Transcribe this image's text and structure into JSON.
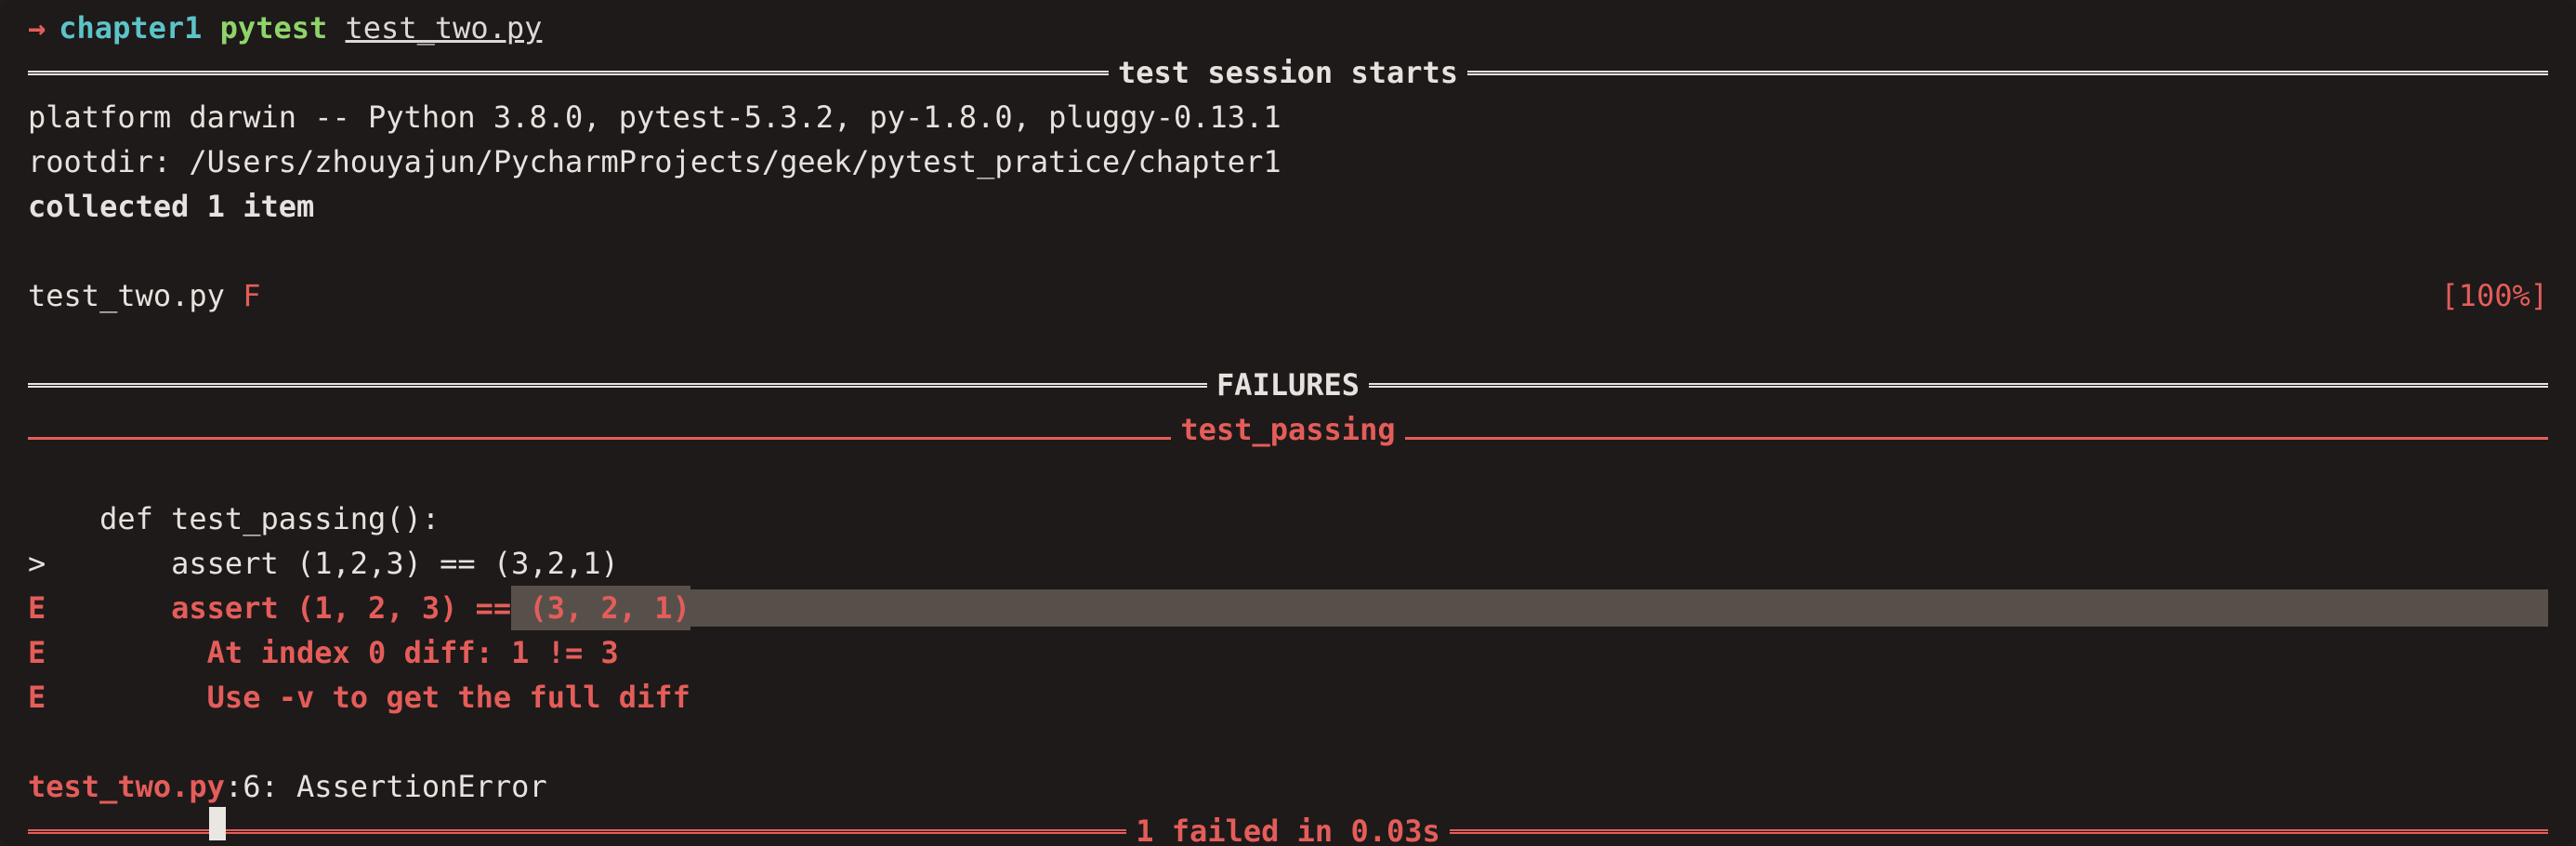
{
  "prompt": {
    "arrow": "→",
    "dir": "chapter1",
    "cmd": "pytest",
    "arg": "test_two.py"
  },
  "session_header": "test session starts",
  "platform_line": "platform darwin -- Python 3.8.0, pytest-5.3.2, py-1.8.0, pluggy-0.13.1",
  "rootdir_line": "rootdir: /Users/zhouyajun/PycharmProjects/geek/pytest_pratice/chapter1",
  "collected_line": "collected 1 item",
  "result_file": "test_two.py ",
  "result_flag": "F",
  "progress": "[100%]",
  "failures_header": "FAILURES",
  "test_name_header": "test_passing",
  "code": {
    "def_line": "    def test_passing():",
    "assert_marker": ">",
    "assert_line": "       assert (1,2,3) == (3,2,1)",
    "e_marker": "E",
    "e1a": "       assert (1, 2, 3) ==",
    "e1b": " (3, 2, 1)",
    "e2": "         At index 0 diff: 1 != 3",
    "e3": "         Use -v to get the full diff"
  },
  "trace_file": "test_two.py",
  "trace_rest": ":6: AssertionError",
  "summary": "1 failed in 0.03s"
}
